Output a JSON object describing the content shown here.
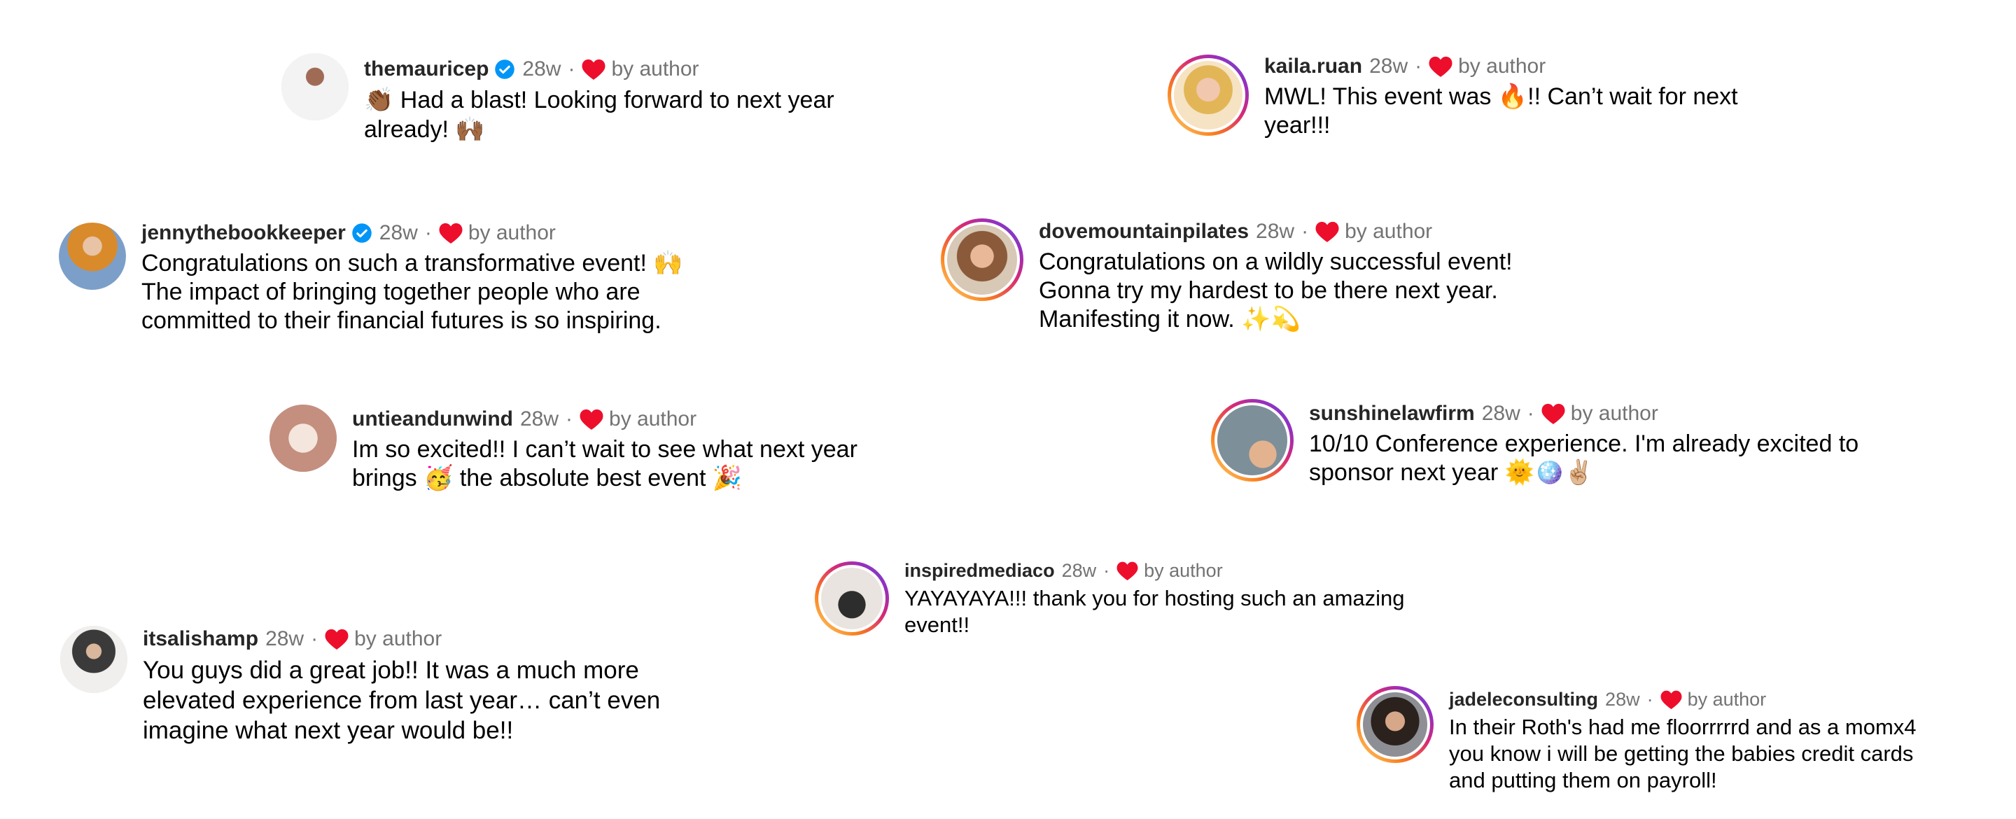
{
  "colors": {
    "heart": "#ed0e2c",
    "verified": "#0095f6",
    "muted": "#737373"
  },
  "comments": [
    {
      "username": "themauricep",
      "verified": true,
      "time": "28w",
      "dot": "·",
      "liked_label": "by author",
      "text": "👏🏾 Had a blast! Looking forward to next year\nalready! 🙌🏾"
    },
    {
      "username": "kaila.ruan",
      "verified": false,
      "time": "28w",
      "dot": "·",
      "liked_label": "by author",
      "text": "MWL! This event was 🔥!! Can’t wait for next\nyear!!!"
    },
    {
      "username": "jennythebookkeeper",
      "verified": true,
      "time": "28w",
      "dot": "·",
      "liked_label": "by author",
      "text": "Congratulations on such a transformative event! 🙌\nThe impact of bringing together people who are\ncommitted to their financial futures is so inspiring."
    },
    {
      "username": "dovemountainpilates",
      "verified": false,
      "time": "28w",
      "dot": "·",
      "liked_label": "by author",
      "text": "Congratulations on a wildly successful event!\nGonna try my hardest to be there next year.\nManifesting it now. ✨💫"
    },
    {
      "username": "untieandunwind",
      "verified": false,
      "time": "28w",
      "dot": "·",
      "liked_label": "by author",
      "text": "Im so excited!! I can’t wait to see what next year\nbrings 🥳 the absolute best event 🎉"
    },
    {
      "username": "sunshinelawfirm",
      "verified": false,
      "time": "28w",
      "dot": "·",
      "liked_label": "by author",
      "text": "10/10 Conference experience. I'm already excited to\nsponsor next year 🌞🪩✌🏼"
    },
    {
      "username": "inspiredmediaco",
      "verified": false,
      "time": "28w",
      "dot": "·",
      "liked_label": "by author",
      "text": "YAYAYAYA!!! thank you for hosting such an amazing\nevent!!"
    },
    {
      "username": "itsalishamp",
      "verified": false,
      "time": "28w",
      "dot": "·",
      "liked_label": "by author",
      "text": "You guys did a great job!! It was a much more\nelevated experience from last year… can’t even\nimagine what next year would be!!"
    },
    {
      "username": "jadeleconsulting",
      "verified": false,
      "time": "28w",
      "dot": "·",
      "liked_label": "by author",
      "text": "In their Roth's had me floorrrrrd and as a momx4\nyou know i will be getting the babies credit cards\nand putting them on payroll!"
    }
  ]
}
